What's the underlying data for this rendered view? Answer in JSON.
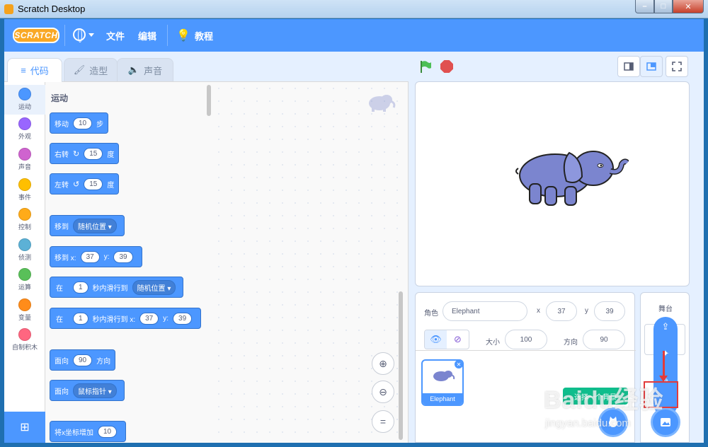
{
  "window": {
    "title": "Scratch Desktop"
  },
  "menubar": {
    "logo": "SCRATCH",
    "file": "文件",
    "edit": "编辑",
    "tutorials": "教程"
  },
  "tabs": {
    "code": "代码",
    "costumes": "造型",
    "sounds": "声音"
  },
  "categories": [
    {
      "label": "运动",
      "color": "#4c97ff"
    },
    {
      "label": "外观",
      "color": "#9966ff"
    },
    {
      "label": "声音",
      "color": "#cf63cf"
    },
    {
      "label": "事件",
      "color": "#ffbf00"
    },
    {
      "label": "控制",
      "color": "#ffab19"
    },
    {
      "label": "侦测",
      "color": "#5cb1d6"
    },
    {
      "label": "运算",
      "color": "#59c059"
    },
    {
      "label": "变量",
      "color": "#ff8c1a"
    },
    {
      "label": "自制积木",
      "color": "#ff6680"
    }
  ],
  "palette": {
    "section_title": "运动",
    "move": {
      "a": "移动",
      "steps": "10",
      "b": "步"
    },
    "turn_right": {
      "a": "右转",
      "deg": "15",
      "b": "度"
    },
    "turn_left": {
      "a": "左转",
      "deg": "15",
      "b": "度"
    },
    "goto": {
      "a": "移到",
      "dd": "随机位置"
    },
    "goto_xy": {
      "a": "移到 x:",
      "x": "37",
      "yl": "y:",
      "y": "39"
    },
    "glide": {
      "a": "在",
      "secs": "1",
      "b": "秒内滑行到",
      "dd": "随机位置"
    },
    "glide_xy": {
      "a": "在",
      "secs": "1",
      "b": "秒内滑行到 x:",
      "x": "37",
      "yl": "y:",
      "y": "39"
    },
    "point_dir": {
      "a": "面向",
      "deg": "90",
      "b": "方向"
    },
    "point_towards": {
      "a": "面向",
      "dd": "鼠标指针"
    },
    "change_x": {
      "a": "将x坐标增加",
      "val": "10"
    }
  },
  "sprite_info": {
    "sprite_label": "角色",
    "name": "Elephant",
    "x_label": "x",
    "x": "37",
    "y_label": "y",
    "y": "39",
    "size_label": "大小",
    "size": "100",
    "dir_label": "方向",
    "direction": "90"
  },
  "sprites": [
    {
      "name": "Elephant"
    }
  ],
  "stage_panel": {
    "label": "舞台"
  },
  "tooltip": "选择一个背景",
  "watermark": {
    "brand": "Baidu经验",
    "url": "jingyan.baidu.com"
  },
  "colors": {
    "accent": "#4c97ff",
    "stop": "#e05050",
    "flag": "#4cbf56",
    "highlight": "#e23b3b"
  }
}
